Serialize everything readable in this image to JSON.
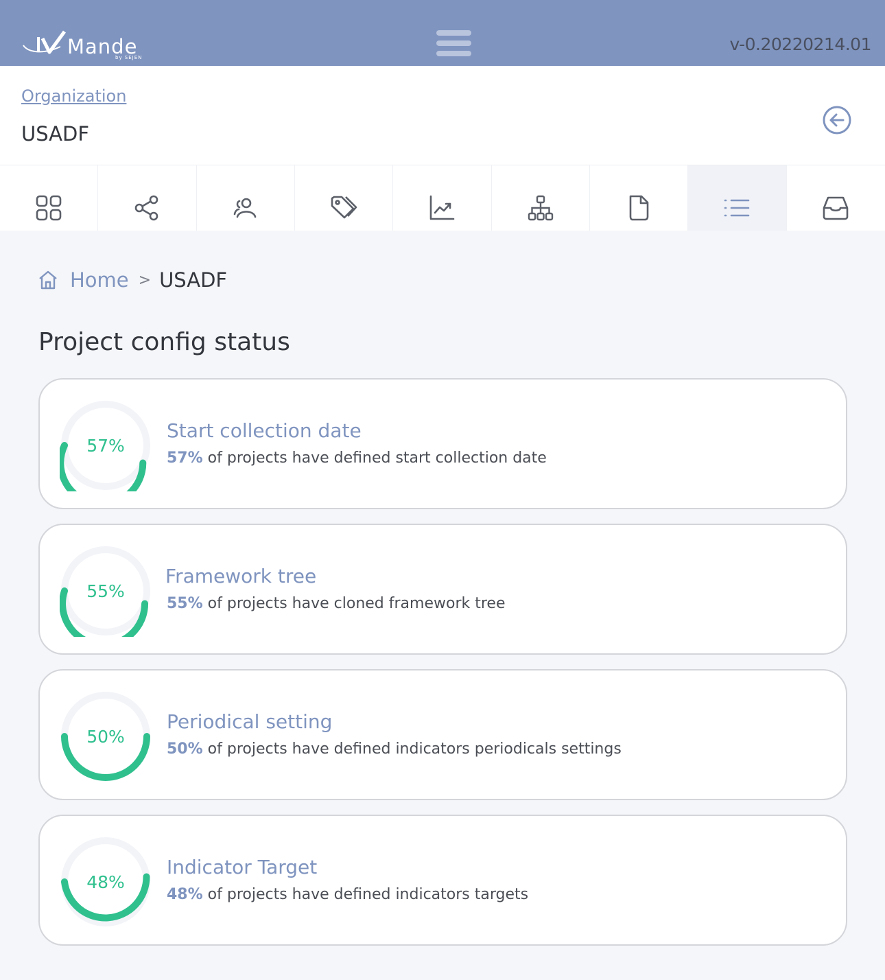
{
  "header": {
    "logo_text": "Mande",
    "logo_sub": "by SEJEN",
    "menu_icon": "hamburger-icon",
    "version": "v-0.20220214.01"
  },
  "org": {
    "link_label": "Organization",
    "name": "USADF",
    "back_icon": "arrow-left-circle-icon"
  },
  "tabs": [
    {
      "icon": "grid-icon",
      "active": false
    },
    {
      "icon": "share-icon",
      "active": false
    },
    {
      "icon": "users-icon",
      "active": false
    },
    {
      "icon": "tag-icon",
      "active": false
    },
    {
      "icon": "chart-line-icon",
      "active": false
    },
    {
      "icon": "org-tree-icon",
      "active": false
    },
    {
      "icon": "file-icon",
      "active": false
    },
    {
      "icon": "list-icon",
      "active": true
    },
    {
      "icon": "inbox-icon",
      "active": false
    }
  ],
  "breadcrumb": {
    "home_icon": "home-icon",
    "home": "Home",
    "separator": ">",
    "current": "USADF"
  },
  "page_title": "Project config status",
  "colors": {
    "accent": "#7f94bf",
    "progress": "#2fc08e",
    "track": "#f3f4f8"
  },
  "cards": [
    {
      "percent": 57,
      "percent_label": "57%",
      "title": "Start collection date",
      "desc_pct": "57%",
      "desc_text": " of projects have defined start collection date"
    },
    {
      "percent": 55,
      "percent_label": "55%",
      "title": "Framework tree",
      "desc_pct": "55%",
      "desc_text": " of projects have cloned framework tree"
    },
    {
      "percent": 50,
      "percent_label": "50%",
      "title": "Periodical setting",
      "desc_pct": "50%",
      "desc_text": " of projects have defined indicators periodicals settings"
    },
    {
      "percent": 48,
      "percent_label": "48%",
      "title": "Indicator Target",
      "desc_pct": "48%",
      "desc_text": " of projects have defined indicators targets"
    }
  ]
}
